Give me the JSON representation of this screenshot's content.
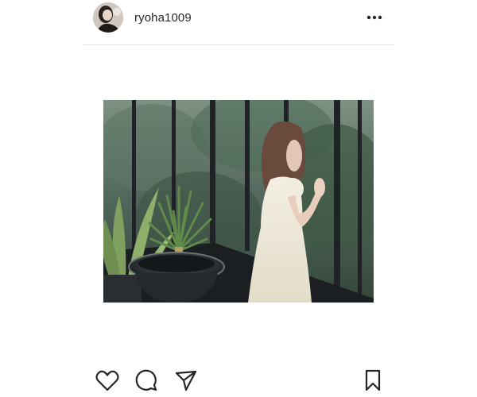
{
  "post": {
    "username": "ryoha1009"
  },
  "icons": {
    "more": "more-options-icon",
    "like": "heart-icon",
    "comment": "comment-icon",
    "share": "paper-plane-icon",
    "save": "bookmark-icon"
  },
  "colors": {
    "text": "#262626",
    "divider": "#e6e6e6",
    "icon": "#262626"
  }
}
